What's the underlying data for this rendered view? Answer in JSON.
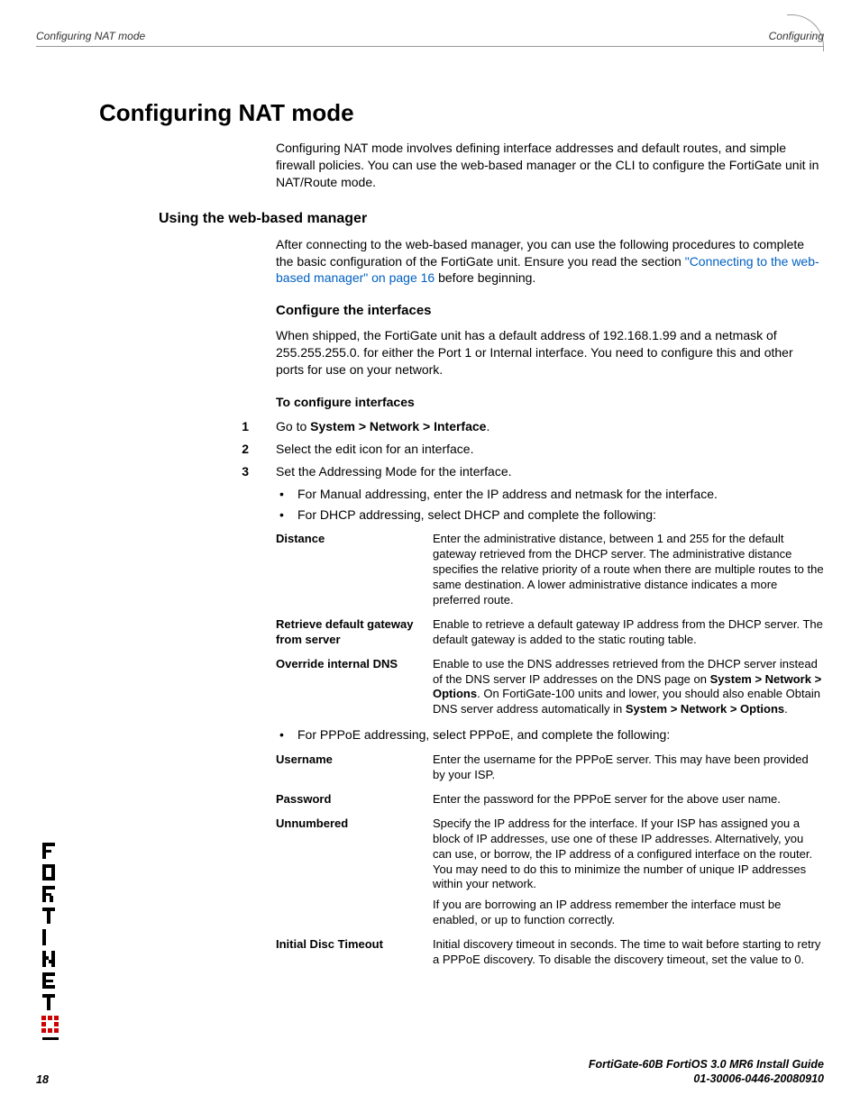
{
  "header": {
    "left": "Configuring NAT mode",
    "right": "Configuring"
  },
  "h1": "Configuring NAT mode",
  "intro": "Configuring NAT mode involves defining interface addresses and default routes, and simple firewall policies. You can use the web-based manager or the CLI to configure the FortiGate unit in NAT/Route mode.",
  "h2": "Using the web-based manager",
  "p2a": "After connecting to the web-based manager, you can use the following procedures to complete the basic configuration of the FortiGate unit. Ensure you read the section ",
  "p2link": "\"Connecting to the web-based manager\" on page 16",
  "p2b": " before beginning.",
  "h3": "Configure the interfaces",
  "p3": "When shipped, the FortiGate unit has a default address of 192.168.1.99 and a netmask of 255.255.255.0. for either the Port 1 or Internal interface. You need to configure this and other ports for use on your network.",
  "proc": "To configure interfaces",
  "step1_pre": "Go to ",
  "step1_bold": "System > Network > Interface",
  "step1_post": ".",
  "step2": "Select the edit icon for an interface.",
  "step3": "Set the Addressing Mode for the interface.",
  "bullet_a": "For Manual addressing, enter the IP address and netmask for the interface.",
  "bullet_b": "For DHCP addressing, select DHCP and complete the following:",
  "t1r1l": "Distance",
  "t1r1r": "Enter the administrative distance, between 1 and 255 for the default gateway retrieved from the DHCP server. The administrative distance specifies the relative priority of a route when there are multiple routes to the same destination. A lower administrative distance indicates a more preferred route.",
  "t1r2l": "Retrieve default gateway from server",
  "t1r2r": "Enable to retrieve a default gateway IP address from the DHCP server. The default gateway is added to the static routing table.",
  "t1r3l": "Override internal DNS",
  "t1r3r_a": "Enable to use the DNS addresses retrieved from the DHCP server instead of the DNS server IP addresses on the DNS page on ",
  "t1r3r_b1": "System > Network > Options",
  "t1r3r_c": ". On FortiGate-100 units and lower, you should also enable Obtain DNS server address automatically in ",
  "t1r3r_b2": "System > Network > Options",
  "t1r3r_d": ".",
  "bullet_c": "For PPPoE addressing, select PPPoE, and complete the following:",
  "t2r1l": "Username",
  "t2r1r": "Enter the username for the PPPoE server. This may have been provided by your ISP.",
  "t2r2l": "Password",
  "t2r2r": "Enter the password for the PPPoE server for the above user name.",
  "t2r3l": "Unnumbered",
  "t2r3r1": "Specify the IP address for the interface. If your ISP has assigned you a block of IP addresses, use one of these IP addresses. Alternatively, you can use, or borrow, the IP address of a configured interface on the router. You may need to do this to minimize the number of unique IP addresses within your network.",
  "t2r3r2": "If you are borrowing an IP address remember the interface must be enabled, or up to function correctly.",
  "t2r4l": "Initial Disc Timeout",
  "t2r4r": "Initial discovery timeout in seconds. The time to wait before starting to retry a PPPoE discovery. To disable the discovery timeout, set the value to 0.",
  "footer1": "FortiGate-60B FortiOS 3.0 MR6 Install Guide",
  "footer2": "01-30006-0446-20080910",
  "page_num": "18"
}
